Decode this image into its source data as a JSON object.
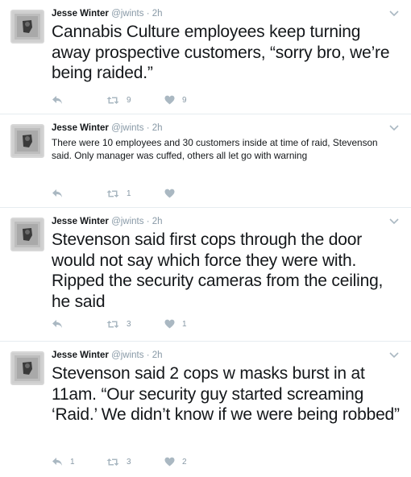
{
  "tweets": [
    {
      "name": "Jesse Winter",
      "handle": "@jwints",
      "separator": "·",
      "time": "2h",
      "text": "Cannabis Culture employees keep turning away prospective customers, “sorry bro, we’re being raided.”",
      "text_size": "large",
      "reply_count": "",
      "retweet_count": "9",
      "like_count": "9"
    },
    {
      "name": "Jesse Winter",
      "handle": "@jwints",
      "separator": "·",
      "time": "2h",
      "text": "There were 10 employees and 30 customers inside at time of raid, Stevenson said. Only manager was cuffed, others all let go with warning",
      "text_size": "small",
      "reply_count": "",
      "retweet_count": "1",
      "like_count": ""
    },
    {
      "name": "Jesse Winter",
      "handle": "@jwints",
      "separator": "·",
      "time": "2h",
      "text": "Stevenson said first cops through the door would not say which force they were with. Ripped the security cameras from the ceiling, he said",
      "text_size": "large",
      "reply_count": "",
      "retweet_count": "3",
      "like_count": "1"
    },
    {
      "name": "Jesse Winter",
      "handle": "@jwints",
      "separator": "·",
      "time": "2h",
      "text": "Stevenson said 2 cops w masks burst in at 11am. “Our security guy started screaming ‘Raid.’ We didn’t know if we were being robbed”",
      "text_size": "large",
      "reply_count": "1",
      "retweet_count": "3",
      "like_count": "2"
    }
  ],
  "icons": {
    "reply": "reply-icon",
    "retweet": "retweet-icon",
    "like": "heart-icon",
    "more": "chevron-down-icon"
  },
  "colors": {
    "icon": "#aab8c2",
    "meta": "#8899a6",
    "text": "#14171a",
    "divider": "#e6ecf0"
  }
}
